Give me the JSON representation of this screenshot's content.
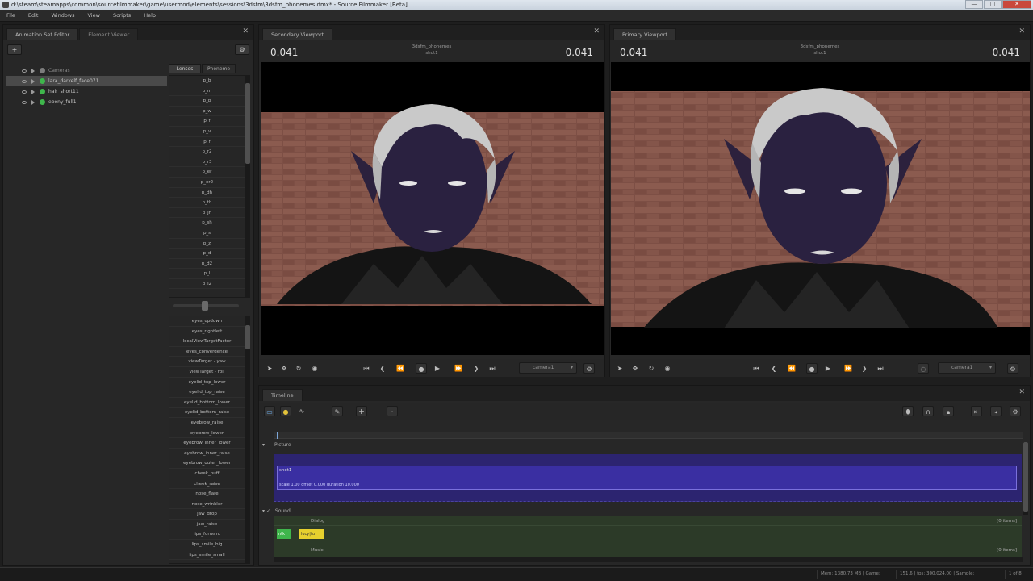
{
  "window": {
    "title": "d:\\steam\\steamapps\\common\\sourcefilmmaker\\game\\usermod\\elements\\sessions\\3dsfm\\3dsfm_phonemes.dmx* - Source Filmmaker [Beta]",
    "min": "—",
    "max": "□",
    "close": "✕"
  },
  "menu": [
    "File",
    "Edit",
    "Windows",
    "View",
    "Scripts",
    "Help"
  ],
  "left_panel": {
    "tabs": [
      "Animation Set Editor",
      "Element Viewer"
    ],
    "close": "✕",
    "add": "+",
    "settings": "⚙",
    "tree": [
      {
        "label": "Cameras",
        "dot": "none",
        "selected": false
      },
      {
        "label": "lara_darkelf_face071",
        "dot": "green",
        "selected": true
      },
      {
        "label": "hair_short11",
        "dot": "green",
        "selected": false
      },
      {
        "label": "ebony_full1",
        "dot": "green",
        "selected": false
      }
    ],
    "filter_tabs": [
      "Lenses",
      "Phoneme"
    ],
    "phonemes": [
      "p_b",
      "p_m",
      "p_p",
      "p_w",
      "p_f",
      "p_v",
      "p_r",
      "p_r2",
      "p_r3",
      "p_er",
      "p_er2",
      "p_dh",
      "p_th",
      "p_jh",
      "p_sh",
      "p_s",
      "p_z",
      "p_d",
      "p_d2",
      "p_l",
      "p_l2"
    ],
    "controls": [
      "eyes_updown",
      "eyes_rightleft",
      "localViewTargetFactor",
      "eyes_convergence",
      "viewTarget - yaw",
      "viewTarget - roll",
      "eyelid_top_lower",
      "eyelid_top_raise",
      "eyelid_bottom_lower",
      "eyelid_bottom_raise",
      "eyebrow_raise",
      "eyebrow_lower",
      "eyebrow_inner_lower",
      "eyebrow_inner_raise",
      "eyebrow_outer_lower",
      "cheek_puff",
      "cheek_raise",
      "nose_flare",
      "nose_wrinkler",
      "jaw_drop",
      "jaw_raise",
      "lips_forward",
      "lips_smile_big",
      "lips_smile_small"
    ]
  },
  "secondary_viewport": {
    "tab": "Secondary Viewport",
    "close": "✕",
    "time_left": "0.041",
    "time_right": "0.041",
    "session": "3dsfm_phonemes",
    "shot": "shot1",
    "camera": "camera1"
  },
  "primary_viewport": {
    "tab": "Primary Viewport",
    "close": "✕",
    "time_left": "0.041",
    "time_right": "0.041",
    "session": "3dsfm_phonemes",
    "shot": "shot1",
    "camera": "camera1"
  },
  "transport": {
    "prev_key": "⏮",
    "prev_frame": "❮",
    "start": "⏪",
    "record": "●",
    "play": "▶",
    "end": "⏩",
    "next_frame": "❯",
    "next_key": "⏭"
  },
  "timeline": {
    "tab": "Timeline",
    "close": "✕",
    "picture_label": "Picture",
    "clip_name": "shot1",
    "clip_info": "scale 1.00 offset 0.000 duration 10.000",
    "sound_label": "Sound",
    "dialog_label": "Dialog",
    "dialog_tag": "[0 items]",
    "music_label": "Music",
    "music_tag": "[0 items]",
    "sound_clips": [
      "ntk",
      "lucy|tu"
    ]
  },
  "status": {
    "memory": "Mem: 1380.73 MB | Game:",
    "fps": "151.6 | fps: 300.024.00 | Sample:",
    "pages": "1 of 8"
  },
  "colors": {
    "picture_track": "#2c2470",
    "clip": "#3a2fa2",
    "sound_track": "#2c3a28",
    "status_green": "#3fb64c",
    "clip_yellow": "#e6d02e"
  }
}
